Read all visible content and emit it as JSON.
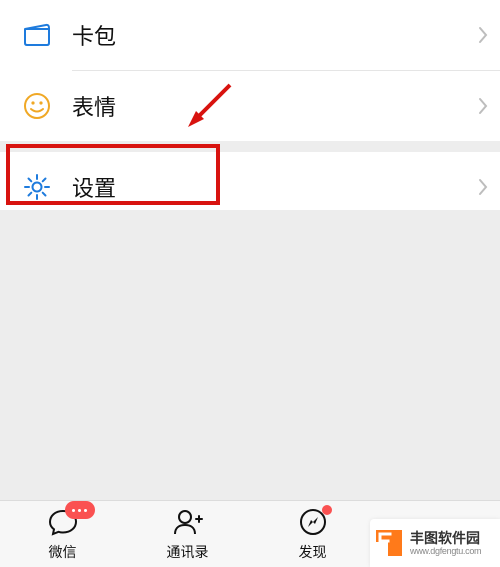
{
  "menu": {
    "items": [
      {
        "id": "card-pack",
        "label": "卡包",
        "iconColor": "#1e7bdd"
      },
      {
        "id": "stickers",
        "label": "表情",
        "iconColor": "#f0a825"
      },
      {
        "id": "settings",
        "label": "设置",
        "iconColor": "#1e7bdd"
      }
    ]
  },
  "tabs": [
    {
      "id": "chat",
      "label": "微信"
    },
    {
      "id": "contacts",
      "label": "通讯录"
    },
    {
      "id": "discover",
      "label": "发现"
    },
    {
      "id": "me",
      "label": ""
    }
  ],
  "watermark": {
    "title": "丰图软件园",
    "subtitle": "www.dgfengtu.com"
  },
  "colors": {
    "highlight": "#d8130f",
    "badge": "#fa5151"
  }
}
